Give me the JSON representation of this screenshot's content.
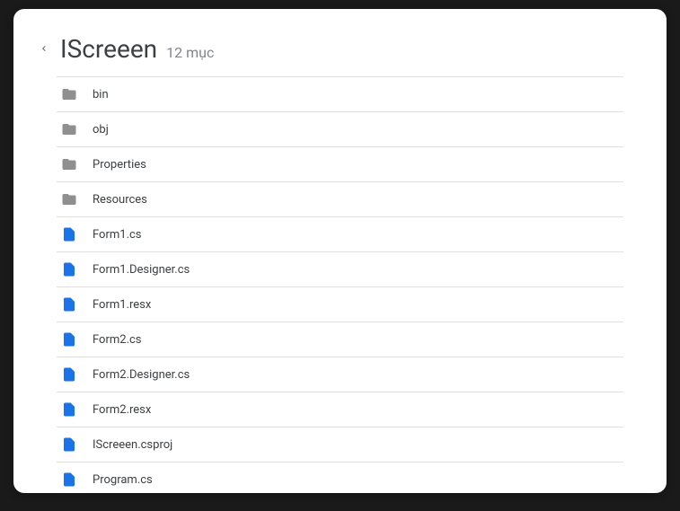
{
  "header": {
    "title": "IScreeen",
    "count": "12 mục"
  },
  "items": [
    {
      "type": "folder",
      "name": "bin"
    },
    {
      "type": "folder",
      "name": "obj"
    },
    {
      "type": "folder",
      "name": "Properties"
    },
    {
      "type": "folder",
      "name": "Resources"
    },
    {
      "type": "file",
      "name": "Form1.cs"
    },
    {
      "type": "file",
      "name": "Form1.Designer.cs"
    },
    {
      "type": "file",
      "name": "Form1.resx"
    },
    {
      "type": "file",
      "name": "Form2.cs"
    },
    {
      "type": "file",
      "name": "Form2.Designer.cs"
    },
    {
      "type": "file",
      "name": "Form2.resx"
    },
    {
      "type": "file",
      "name": "IScreeen.csproj"
    },
    {
      "type": "file",
      "name": "Program.cs"
    }
  ]
}
